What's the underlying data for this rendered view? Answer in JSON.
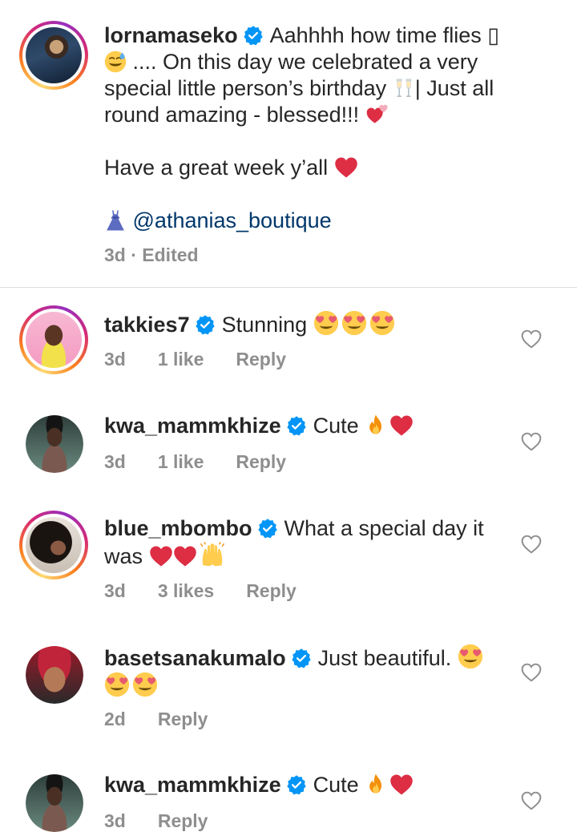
{
  "caption": {
    "username": "lornamaseko",
    "line1_text": "Aahhhh how time flies",
    "line1_glyph": "▯",
    "line2_text": ".... On this day we celebrated a  very",
    "line3_text": "special little person’s birthday",
    "line3_after": "| Just all",
    "line4_text": "round amazing - blessed!!!",
    "line5_text": "Have a great week y’all",
    "mention": "@athanias_boutique",
    "time": "3d",
    "edited": "Edited",
    "separator": "·"
  },
  "comments": [
    {
      "username": "takkies7",
      "text": "Stunning",
      "time": "3d",
      "likes": "1 like",
      "reply": "Reply"
    },
    {
      "username": "kwa_mammkhize",
      "text": "Cute",
      "time": "3d",
      "likes": "1 like",
      "reply": "Reply"
    },
    {
      "username": "blue_mbombo",
      "text": "What a special day it",
      "text2": "was",
      "time": "3d",
      "likes": "3 likes",
      "reply": "Reply"
    },
    {
      "username": "basetsanakumalo",
      "text": "Just beautiful.",
      "time": "2d",
      "reply": "Reply"
    },
    {
      "username": "kwa_mammkhize",
      "text": "Cute",
      "time": "3d",
      "reply": "Reply"
    }
  ],
  "colors": {
    "verified": "#0095f6",
    "meta": "#8e8e8e",
    "mention": "#00376b",
    "heart_red": "#ed1c24"
  }
}
